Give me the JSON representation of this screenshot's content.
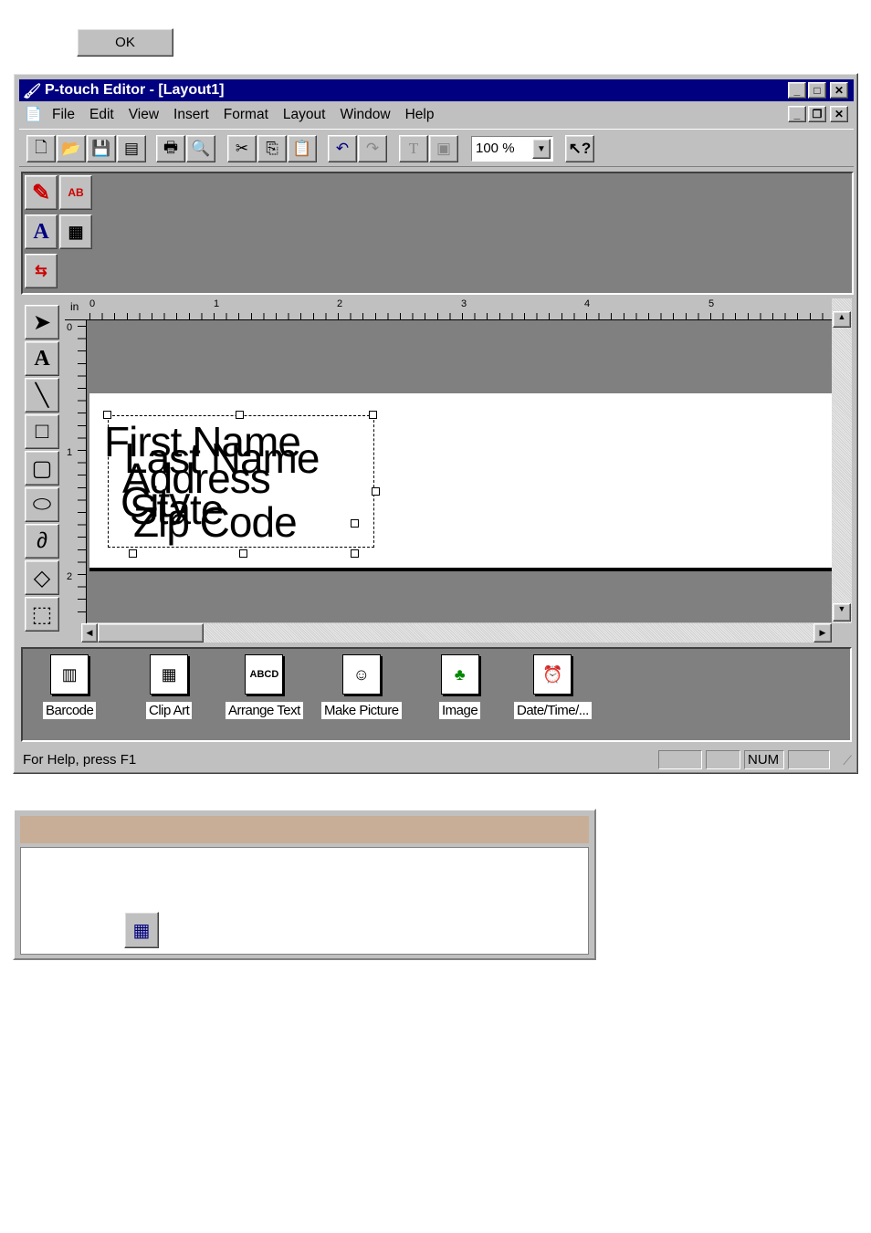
{
  "ok_button": {
    "label": "OK"
  },
  "window": {
    "title": "P-touch Editor - [Layout1]",
    "caption_buttons": {
      "minimize": "_",
      "maximize": "□",
      "close": "✕"
    },
    "doc_buttons": {
      "minimize": "_",
      "restore": "❐",
      "close": "✕"
    },
    "menu": [
      "File",
      "Edit",
      "View",
      "Insert",
      "Format",
      "Layout",
      "Window",
      "Help"
    ],
    "toolbar": {
      "zoom_value": "100 %"
    },
    "rulers": {
      "unit": "in",
      "h_ticks": [
        "0",
        "1",
        "2",
        "3",
        "4",
        "5"
      ],
      "v_ticks": [
        "0",
        "1",
        "2"
      ]
    },
    "label_fields": [
      "First Name",
      "Last Name",
      "Address",
      "City",
      "State",
      "Zip Code"
    ],
    "palette": [
      {
        "label": "Barcode",
        "icon": "barcode-icon"
      },
      {
        "label": "Clip Art",
        "icon": "clip-art-icon"
      },
      {
        "label": "Arrange Text",
        "icon": "arrange-text-icon"
      },
      {
        "label": "Make Picture",
        "icon": "make-picture-icon"
      },
      {
        "label": "Image",
        "icon": "image-icon"
      },
      {
        "label": "Date/Time/...",
        "icon": "date-time-icon"
      }
    ],
    "status": {
      "help": "For Help, press F1",
      "num": "NUM"
    }
  },
  "colors": {
    "titlebar": "#000080",
    "face": "#c0c0c0",
    "workspace": "#808080",
    "panel_header": "#c8ae96"
  }
}
